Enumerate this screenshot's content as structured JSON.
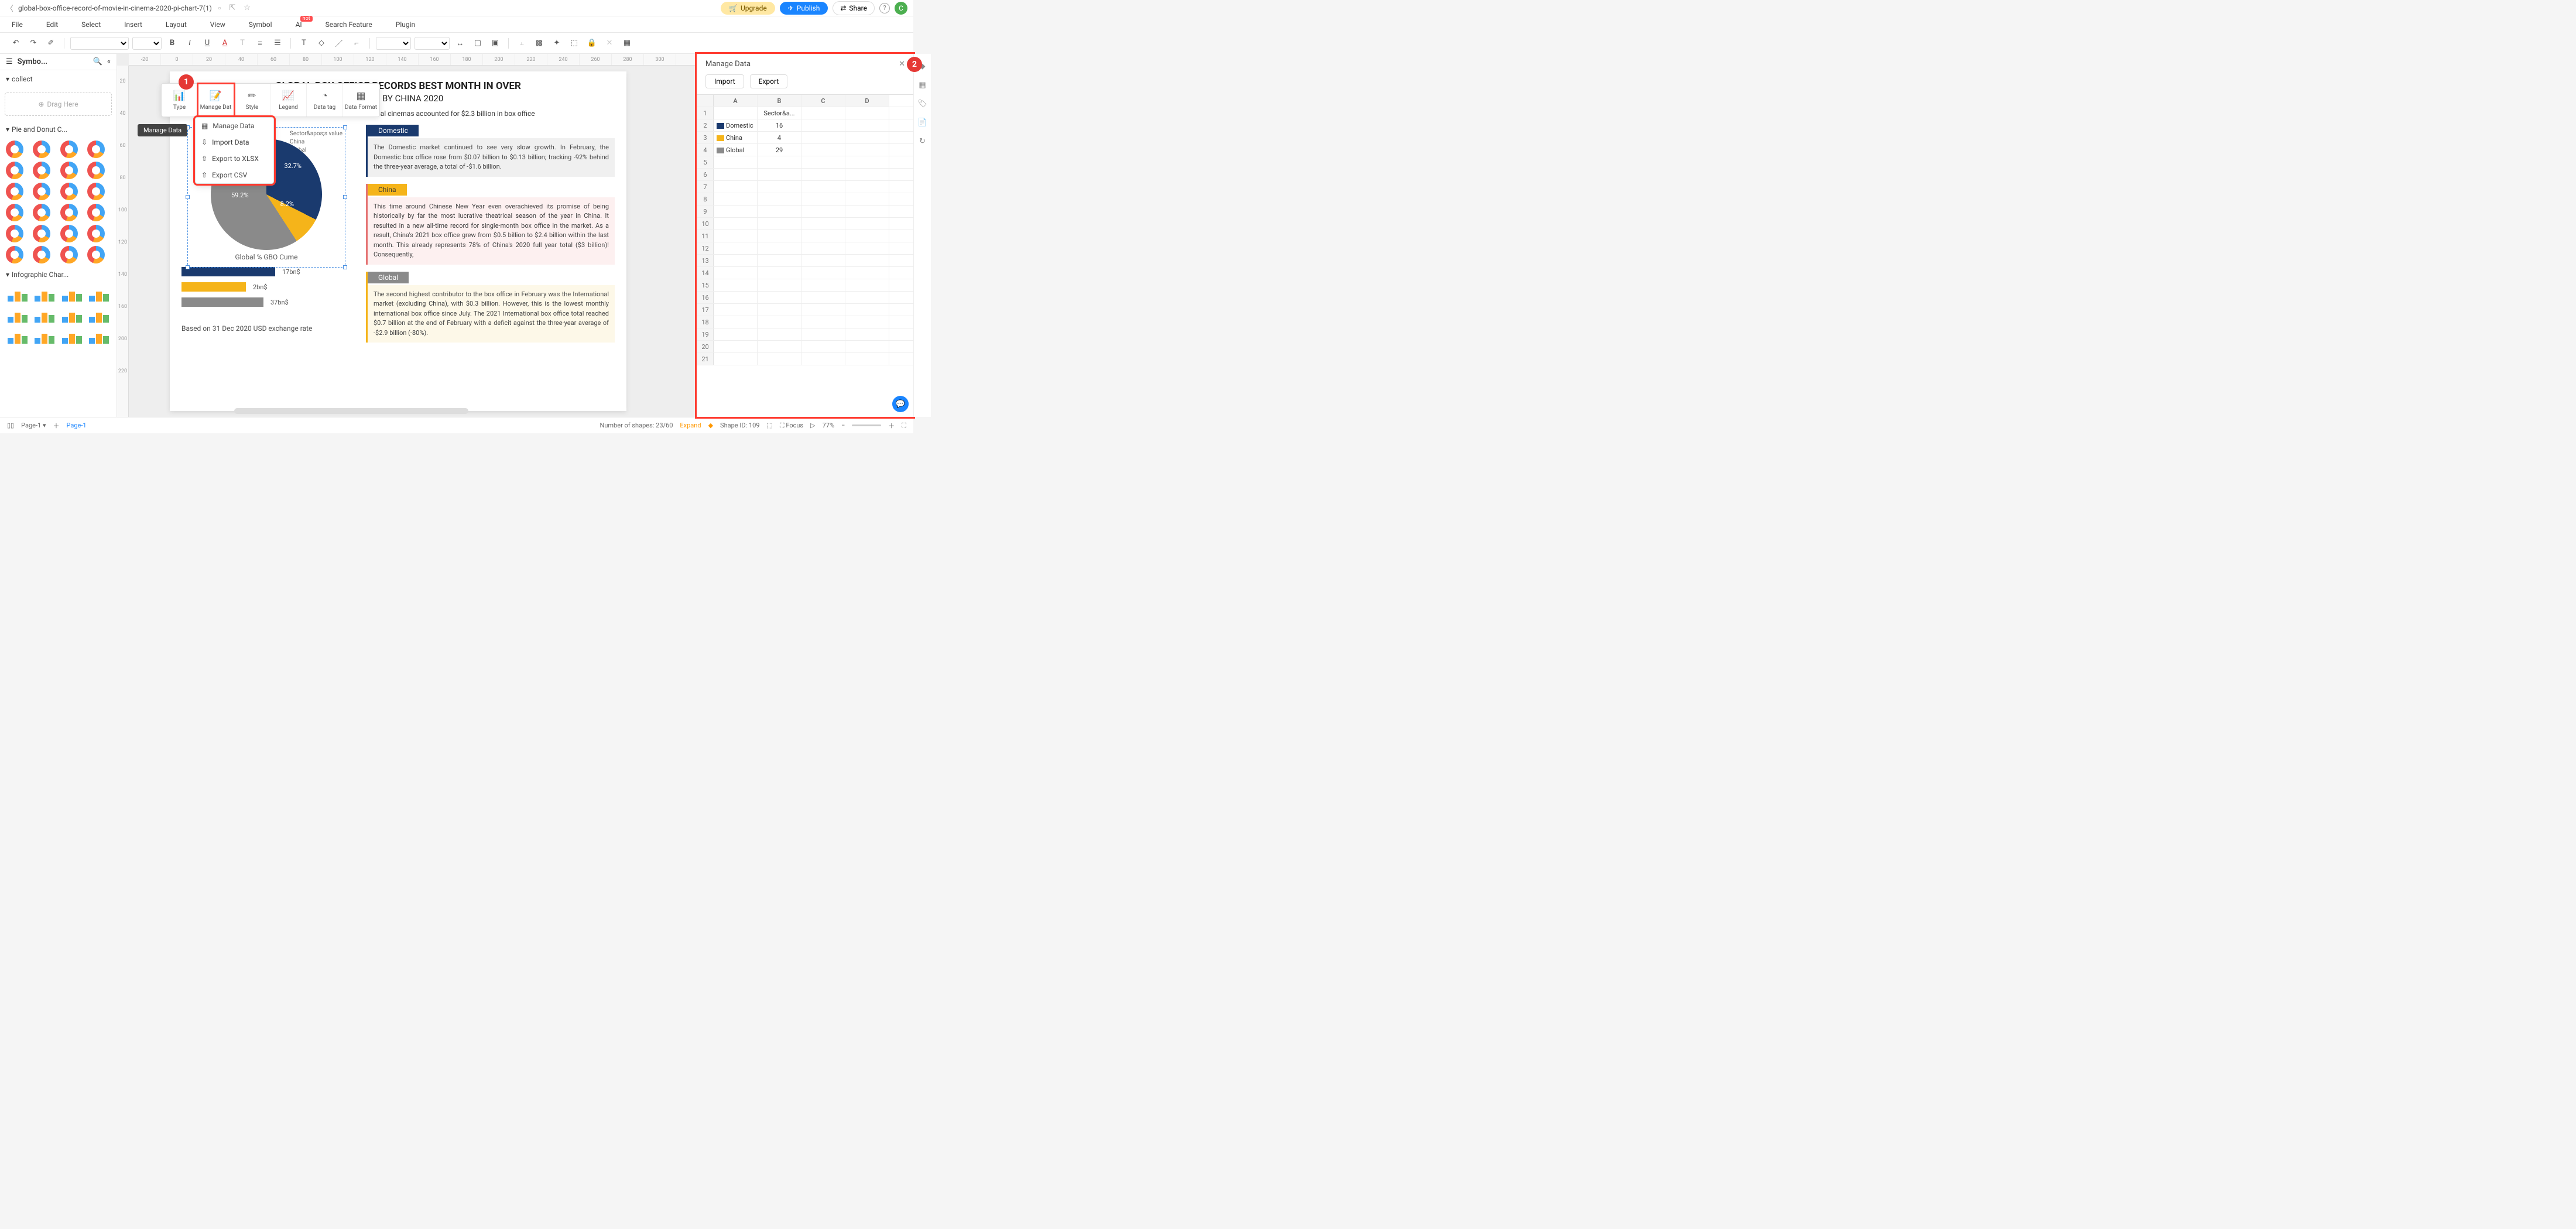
{
  "titlebar": {
    "filename": "global-box-office-record-of-movie-in-cinema-2020-pi-chart-7(1)",
    "upgrade": "Upgrade",
    "publish": "Publish",
    "share": "Share",
    "avatar_initial": "C"
  },
  "menubar": [
    "File",
    "Edit",
    "Select",
    "Insert",
    "Layout",
    "View",
    "Symbol",
    "AI",
    "Search Feature",
    "Plugin"
  ],
  "sidebar": {
    "title": "Symbo...",
    "collect": "collect",
    "drag_here": "Drag Here",
    "pie_section": "Pie and Donut C...",
    "info_section": "Infographic Char..."
  },
  "ruler_h": [
    "-20",
    "0",
    "20",
    "40",
    "60",
    "80",
    "100",
    "120",
    "140",
    "160",
    "180",
    "200",
    "220",
    "240",
    "260",
    "280",
    "300"
  ],
  "ruler_v": [
    "20",
    "40",
    "60",
    "80",
    "100",
    "120",
    "140",
    "160",
    "200",
    "220"
  ],
  "float_toolbar": {
    "tooltip": "Manage Data",
    "items": [
      {
        "label": "Type",
        "icon": "📊"
      },
      {
        "label": "Manage Dat",
        "icon": "📝"
      },
      {
        "label": "Style",
        "icon": "✏"
      },
      {
        "label": "Legend",
        "icon": "📈"
      },
      {
        "label": "Data tag",
        "icon": "◔"
      },
      {
        "label": "Data Format",
        "icon": "▦"
      }
    ],
    "dropdown": [
      {
        "label": "Manage Data",
        "icon": "▦"
      },
      {
        "label": "Import Data",
        "icon": "⇩"
      },
      {
        "label": "Export to XLSX",
        "icon": "⇧"
      },
      {
        "label": "Export CSV",
        "icon": "⇧"
      }
    ]
  },
  "page_content": {
    "title_line1": "GLOBAL BOX OFFICE RECORDS BEST MONTH IN OVER",
    "title_line2": "OSTED BY CHINA 2020",
    "legend_header": "Sector&apos;s value",
    "legend_items": [
      "China",
      "Global"
    ],
    "pie_labels": {
      "l1": "32.7%",
      "l2": "8.2%",
      "l3": "59.2%"
    },
    "pie_caption": "Global % GBO Cume",
    "bars": [
      {
        "w": 160,
        "color": "#1a3a6e",
        "val": "17bn$"
      },
      {
        "w": 110,
        "color": "#f5b41a",
        "val": "2bn$"
      },
      {
        "w": 140,
        "color": "#8a8a8a",
        "val": "37bn$"
      }
    ],
    "footnote": "Based on 31 Dec 2020 USD exchange rate",
    "global_line": "Global cinemas accounted for $2.3 billion in box office",
    "blocks": {
      "domestic": {
        "tag": "Domestic",
        "body": "The Domestic market continued to see very slow growth. In February, the Domestic box office rose from $0.07 billion to $0.13 billion; tracking -92% behind the three-year average, a total of -$1.6 billion."
      },
      "china": {
        "tag": "China",
        "body": "This time around Chinese New Year even overachieved its promise of being historically by far the most lucrative theatrical season of the year in China. It resulted in a new all-time record for single-month box office in the market. As a result, China's 2021 box office grew from $0.5 billion to $2.4 billion within the last month. This already represents 78% of China's 2020 full year total ($3 billion)! Consequently,"
      },
      "global": {
        "tag": "Global",
        "body": "The second highest contributor to the box office in February was the International market (excluding China), with $0.3 billion. However, this is the lowest monthly international box office since July. The 2021 International box office total reached $0.7 billion at the end of February with a deficit against the three-year average of -$2.9 billion (-80%)."
      }
    }
  },
  "right_panel": {
    "title": "Manage Data",
    "import": "Import",
    "export": "Export",
    "cols": [
      "A",
      "B",
      "C",
      "D"
    ],
    "rows": [
      {
        "n": "1",
        "a": "",
        "b": "Sector&a...",
        "c": "",
        "d": ""
      },
      {
        "n": "2",
        "color": "#1a3a6e",
        "a": "Domestic",
        "b": "16",
        "c": "",
        "d": ""
      },
      {
        "n": "3",
        "color": "#f5b41a",
        "a": "China",
        "b": "4",
        "c": "",
        "d": ""
      },
      {
        "n": "4",
        "color": "#8a8a8a",
        "a": "Global",
        "b": "29",
        "c": "",
        "d": ""
      },
      {
        "n": "5"
      },
      {
        "n": "6"
      },
      {
        "n": "7"
      },
      {
        "n": "8"
      },
      {
        "n": "9"
      },
      {
        "n": "10"
      },
      {
        "n": "11"
      },
      {
        "n": "12"
      },
      {
        "n": "13"
      },
      {
        "n": "14"
      },
      {
        "n": "15"
      },
      {
        "n": "16"
      },
      {
        "n": "17"
      },
      {
        "n": "18"
      },
      {
        "n": "19"
      },
      {
        "n": "20"
      },
      {
        "n": "21"
      }
    ]
  },
  "status": {
    "page_tab": "Page-1",
    "page_sel": "Page-1",
    "shapes": "Number of shapes: 23/60",
    "expand": "Expand",
    "shape_id": "Shape ID: 109",
    "focus": "Focus",
    "zoom": "77%"
  },
  "chart_data": {
    "type": "pie",
    "title": "Global % GBO Cume",
    "series": [
      {
        "name": "Sector's value",
        "values": [
          32.7,
          8.2,
          59.2
        ]
      }
    ],
    "categories": [
      "Domestic",
      "China",
      "Global"
    ],
    "colors": [
      "#1a3a6e",
      "#f5b41a",
      "#8a8a8a"
    ],
    "secondary_bars": {
      "type": "bar",
      "categories": [
        "Domestic",
        "China",
        "Global"
      ],
      "values": [
        17,
        2,
        37
      ],
      "unit": "bn$"
    },
    "data_table": {
      "header": "Sector&a...",
      "rows": [
        [
          "Domestic",
          16
        ],
        [
          "China",
          4
        ],
        [
          "Global",
          29
        ]
      ]
    }
  }
}
